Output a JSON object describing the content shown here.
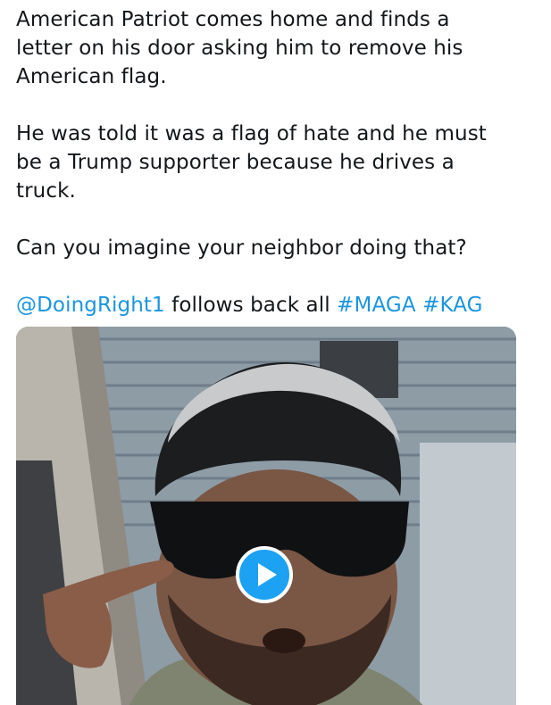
{
  "tweet": {
    "paragraphs": [
      {
        "lines": [
          "American Patriot comes home and finds a",
          "letter on his door asking him to remove his",
          "American flag."
        ]
      },
      {
        "lines": [
          "He was told it was a flag of hate and he must",
          "be a Trump supporter because he drives a",
          "truck."
        ]
      },
      {
        "lines": [
          "Can you imagine your neighbor doing that?"
        ]
      }
    ],
    "mention": "@DoingRight1",
    "middle_text": " follows back all ",
    "hashtags": [
      "#MAGA",
      "#KAG"
    ]
  },
  "media": {
    "type": "video",
    "play_icon": "play-icon"
  },
  "colors": {
    "link": "#1b95e0",
    "play_button": "#1da1f2",
    "text": "#14171a"
  }
}
